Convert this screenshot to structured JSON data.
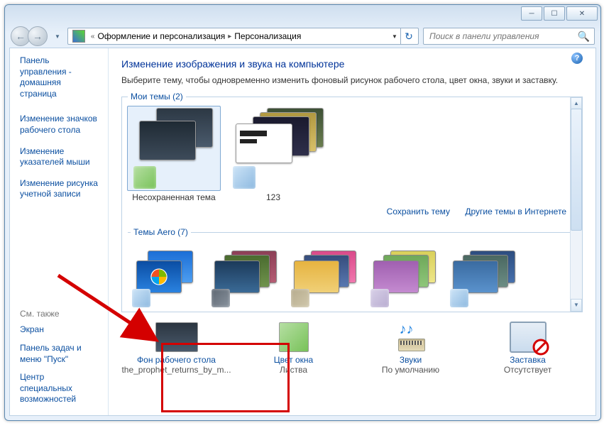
{
  "breadcrumb": {
    "level1": "Оформление и персонализация",
    "level2": "Персонализация"
  },
  "search": {
    "placeholder": "Поиск в панели управления"
  },
  "sidebar": {
    "home": "Панель управления - домашняя страница",
    "links": [
      "Изменение значков рабочего стола",
      "Изменение указателей мыши",
      "Изменение рисунка учетной записи"
    ],
    "see_also_title": "См. также",
    "see_also": [
      "Экран",
      "Панель задач и меню \"Пуск\"",
      "Центр специальных возможностей"
    ]
  },
  "main": {
    "title": "Изменение изображения и звука на компьютере",
    "subtitle": "Выберите тему, чтобы одновременно изменить фоновый рисунок рабочего стола, цвет окна, звуки и заставку.",
    "section_my": "Мои темы (2)",
    "section_aero": "Темы Aero (7)",
    "theme1_label": "Несохраненная тема",
    "theme2_label": "123",
    "link_save": "Сохранить тему",
    "link_more": "Другие темы в Интернете"
  },
  "config": {
    "bg_title": "Фон рабочего стола",
    "bg_value": "the_prophet_returns_by_m...",
    "color_title": "Цвет окна",
    "color_value": "Листва",
    "sound_title": "Звуки",
    "sound_value": "По умолчанию",
    "saver_title": "Заставка",
    "saver_value": "Отсутствует"
  }
}
